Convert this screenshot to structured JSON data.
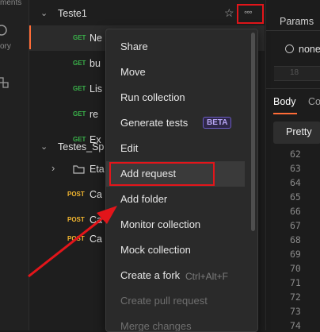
{
  "rail": {
    "item1": "ments",
    "item2": "ory"
  },
  "sidebar": {
    "collections": [
      {
        "name": "Teste1"
      },
      {
        "name": "Testes_Sp"
      }
    ],
    "requests_teste1": [
      {
        "method": "GET",
        "name": "Ne"
      },
      {
        "method": "GET",
        "name": "bu"
      },
      {
        "method": "GET",
        "name": "Lis"
      },
      {
        "method": "GET",
        "name": "re"
      },
      {
        "method": "GET",
        "name": "Ex"
      }
    ],
    "folder": {
      "name": "Eta"
    },
    "requests_testes": [
      {
        "method": "POST",
        "name": "Ca"
      },
      {
        "method": "POST",
        "name": "Ca"
      },
      {
        "method": "POST",
        "name": "Ca"
      }
    ]
  },
  "context_menu": {
    "items": [
      {
        "label": "Share"
      },
      {
        "label": "Move"
      },
      {
        "label": "Run collection"
      },
      {
        "label": "Generate tests",
        "badge": "BETA"
      },
      {
        "label": "Edit"
      },
      {
        "label": "Add request"
      },
      {
        "label": "Add folder"
      },
      {
        "label": "Monitor collection"
      },
      {
        "label": "Mock collection"
      },
      {
        "label": "Create a fork",
        "shortcut": "Ctrl+Alt+F"
      },
      {
        "label": "Create pull request"
      },
      {
        "label": "Merge changes"
      }
    ]
  },
  "right_panel": {
    "params_tab": "Params",
    "radio_label": "none",
    "hidden_line": "18",
    "tab_body": "Body",
    "tab_cookies": "Co",
    "pretty_button": "Pretty",
    "line_numbers": [
      "62",
      "63",
      "64",
      "65",
      "66",
      "67",
      "68",
      "69",
      "70",
      "71",
      "72",
      "73",
      "74"
    ]
  },
  "colors": {
    "get": "#3ab14a",
    "post": "#f2b630",
    "annotation_red": "#e3151a",
    "active_indicator": "#ff6c37"
  }
}
